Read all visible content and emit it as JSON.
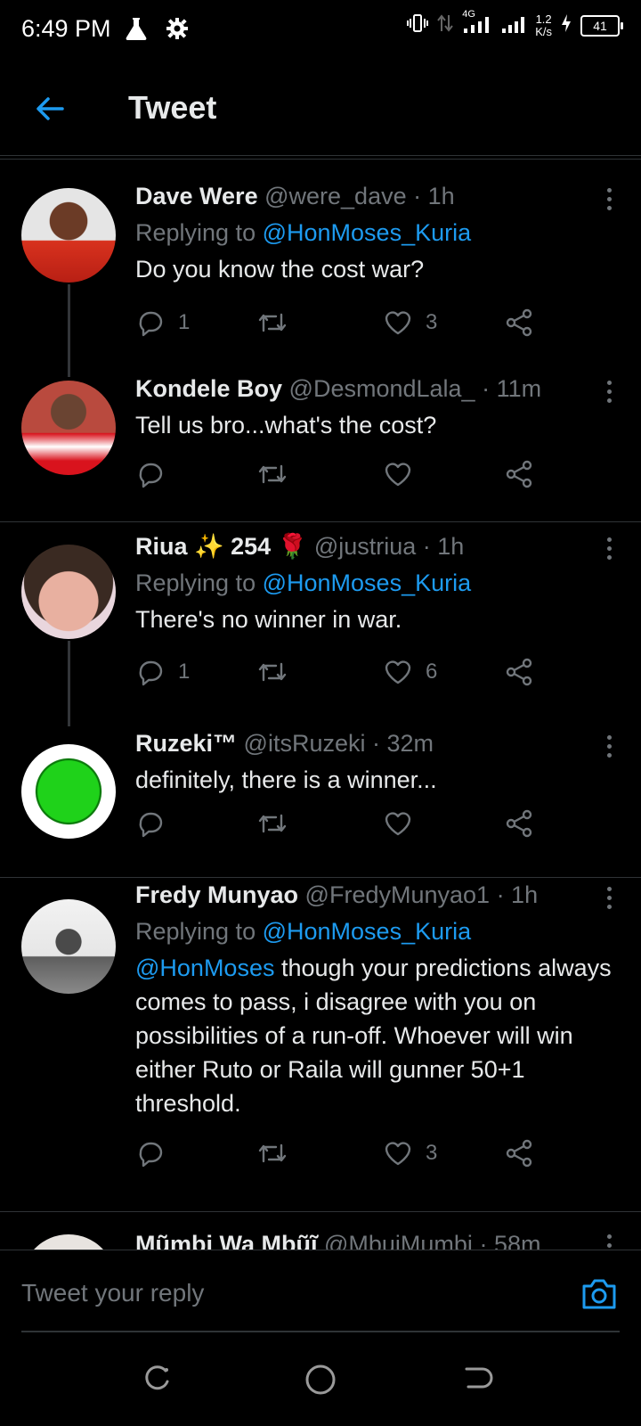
{
  "status_bar": {
    "time": "6:49 PM",
    "network_type": "4G",
    "speed_value": "1.2",
    "speed_unit": "K/s",
    "battery": "41"
  },
  "header": {
    "title": "Tweet"
  },
  "replies": [
    {
      "name": "Dave Were",
      "handle": "@were_dave",
      "time": "· 1h",
      "replying_prefix": "Replying to",
      "replying_to": "@HonMoses_Kuria",
      "text": "Do you know the cost war?",
      "reply_count": "1",
      "like_count": "3"
    },
    {
      "name": "Kondele Boy",
      "handle": "@DesmondLala_",
      "time": "· 11m",
      "text": "Tell us bro...what's the cost?"
    },
    {
      "name": "Riua ✨ 254 🌹",
      "handle": "@justriua",
      "time": "· 1h",
      "replying_prefix": "Replying to",
      "replying_to": "@HonMoses_Kuria",
      "text": "There's no winner in war.",
      "reply_count": "1",
      "like_count": "6"
    },
    {
      "name": "Ruzeki™",
      "handle": "@itsRuzeki",
      "time": "· 32m",
      "text": "definitely, there is a winner..."
    },
    {
      "name": "Fredy Munyao",
      "handle": "@FredyMunyao1",
      "time": "· 1h",
      "replying_prefix": "Replying to",
      "replying_to": "@HonMoses_Kuria",
      "text_mention": "@HonMoses",
      "text": " though your predictions always comes to pass, i disagree with you on possibilities of a run-off. Whoever will win either Ruto or Raila will gunner 50+1 threshold.",
      "like_count": "3"
    },
    {
      "name": "Mũmbi Wa Mbũĩ",
      "handle": "@MbuiMumbi",
      "time": "· 58m"
    }
  ],
  "reply_bar": {
    "placeholder": "Tweet your reply"
  },
  "colors": {
    "accent": "#1d9bf0",
    "muted": "#71767b",
    "background": "#000000"
  }
}
